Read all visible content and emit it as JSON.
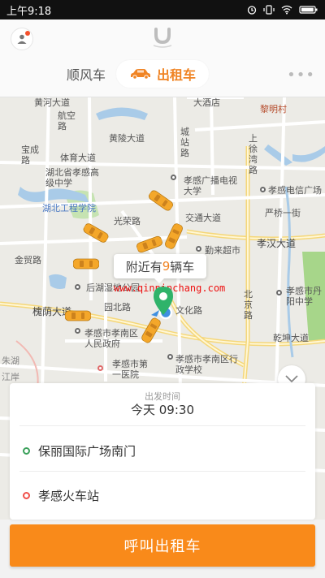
{
  "status_bar": {
    "time": "上午9:18",
    "battery": ""
  },
  "header": {
    "tabs": [
      {
        "label": "顺风车",
        "active": false
      },
      {
        "label": "出租车",
        "active": true
      }
    ],
    "accent_color": "#f08424",
    "more_label": "•••"
  },
  "map": {
    "labels": [
      "黄河大道",
      "大酒店",
      "黎明村",
      "航空路",
      "黄陵大道",
      "城站路",
      "上徐湾路",
      "宝成路",
      "体育大道",
      "湖北省孝感高级中学",
      "孝感广播电视大学",
      "孝感电信广场",
      "湖北工程学院",
      "光荣路",
      "交通大道",
      "严桥一街",
      "勤来超市",
      "孝汉大道",
      "金贸路",
      "后湖湿地公园",
      "北京路",
      "孝感市丹阳中学",
      "槐荫大道",
      "园北路",
      "文化路",
      "乾坤大道",
      "孝感市孝南区人民政府",
      "孝感市孝南区行政学校",
      "孝感市第一医院",
      "朱湖",
      "江岸"
    ],
    "nearby_prefix": "附近有",
    "nearby_count": "9",
    "nearby_suffix": "辆车",
    "watermark": "www.qinpinchang.com"
  },
  "trip": {
    "depart_label": "出发时间",
    "depart_time": "今天 09:30",
    "from": "保丽国际广场南门",
    "to": "孝感火车站"
  },
  "call_button": "呼叫出租车",
  "colors": {
    "button": "#f98a1a",
    "from_dot": "#3aa05a",
    "to_dot": "#f0504a",
    "car": "#f4a72a"
  }
}
